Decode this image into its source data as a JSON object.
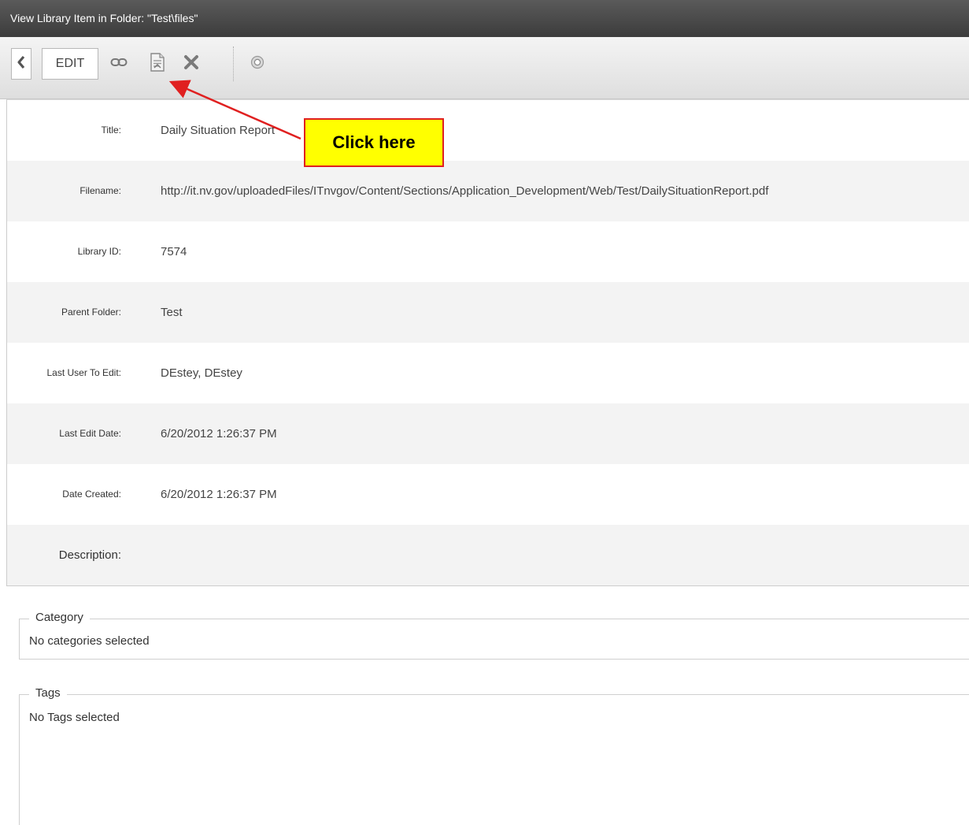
{
  "window": {
    "title": "View Library Item in Folder: \"Test\\files\""
  },
  "toolbar": {
    "back_icon": "chevron-left-icon",
    "edit_label": "EDIT",
    "link_icon": "link-icon",
    "view_file_icon": "document-view-icon",
    "delete_icon": "close-x-icon",
    "help_icon": "help-circle-icon"
  },
  "details": [
    {
      "label": "Title:",
      "value": "Daily Situation Report"
    },
    {
      "label": "Filename:",
      "value": "http://it.nv.gov/uploadedFiles/ITnvgov/Content/Sections/Application_Development/Web/Test/DailySituationReport.pdf"
    },
    {
      "label": "Library ID:",
      "value": "7574"
    },
    {
      "label": "Parent Folder:",
      "value": "Test"
    },
    {
      "label": "Last User To Edit:",
      "value": "DEstey, DEstey"
    },
    {
      "label": "Last Edit Date:",
      "value": "6/20/2012 1:26:37 PM"
    },
    {
      "label": "Date Created:",
      "value": "6/20/2012 1:26:37 PM"
    },
    {
      "label": "Description:",
      "value": ""
    }
  ],
  "category": {
    "legend": "Category",
    "text": "No categories selected"
  },
  "tags": {
    "legend": "Tags",
    "text": "No Tags selected"
  },
  "annotation": {
    "callout_text": "Click here",
    "callout_bg": "#ffff00",
    "callout_border": "#e02020",
    "arrow_color": "#e02020"
  }
}
